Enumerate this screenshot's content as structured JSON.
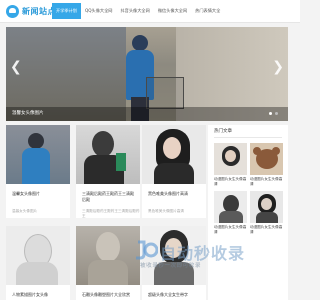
{
  "header": {
    "logo_text": "新闻站点",
    "nav": [
      {
        "label": "开学季计划",
        "active": true
      },
      {
        "label": "QQ头像大全网",
        "active": false
      },
      {
        "label": "抖音头像大全网",
        "active": false
      },
      {
        "label": "微信头像大全网",
        "active": false
      },
      {
        "label": "热门表情大全",
        "active": false
      }
    ]
  },
  "banner": {
    "caption": "温馨女头像图片",
    "prev_icon": "chevron-left-icon",
    "next_icon": "chevron-right-icon"
  },
  "cards": [
    {
      "title": "温馨女头像图片",
      "date": "温馨女头像图片"
    },
    {
      "title": "三清殿后殿药王殿药王三清殿后殿",
      "date": "三清殿后殿药王殿药王三清殿后殿药王"
    },
    {
      "title": "黑色唯美头像图片高清",
      "date": "黑色唯美头像图片高清"
    },
    {
      "title": "人物素描图片女头像",
      "date": ""
    },
    {
      "title": "石雕头像雕塑图片大全欣赏",
      "date": ""
    },
    {
      "title": "超级头像大全女生带字",
      "date": ""
    }
  ],
  "sidebar": {
    "title": "热门文章",
    "items": [
      {
        "caption": "动漫图片女生头像高清"
      },
      {
        "caption": "动漫图片女生头像高清"
      },
      {
        "caption": "动漫图片女生头像高清"
      },
      {
        "caption": "动漫图片女生头像高清"
      }
    ]
  },
  "watermark": {
    "main": "自动秒收录",
    "sub": "被收录秒一次即可收录"
  },
  "colors": {
    "accent": "#35a7e8",
    "page_bg": "#f3f3f3"
  }
}
